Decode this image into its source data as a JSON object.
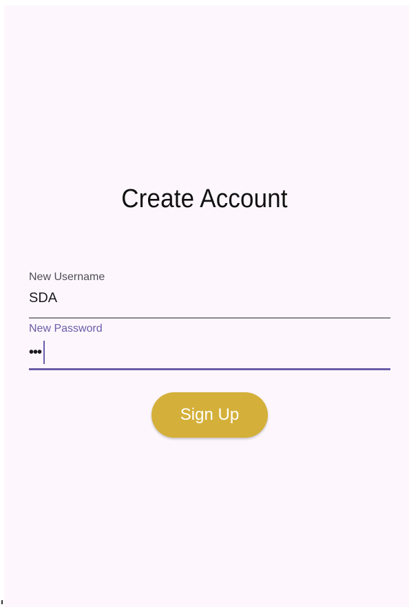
{
  "page": {
    "title": "Create Account"
  },
  "form": {
    "username": {
      "label": "New Username",
      "value": "SDA"
    },
    "password": {
      "label": "New Password",
      "masked_value": "•••",
      "focused": true
    },
    "submit_label": "Sign Up"
  },
  "colors": {
    "background": "#fdf7fd",
    "accent": "#6b5ba8",
    "button": "#d4b03a"
  }
}
